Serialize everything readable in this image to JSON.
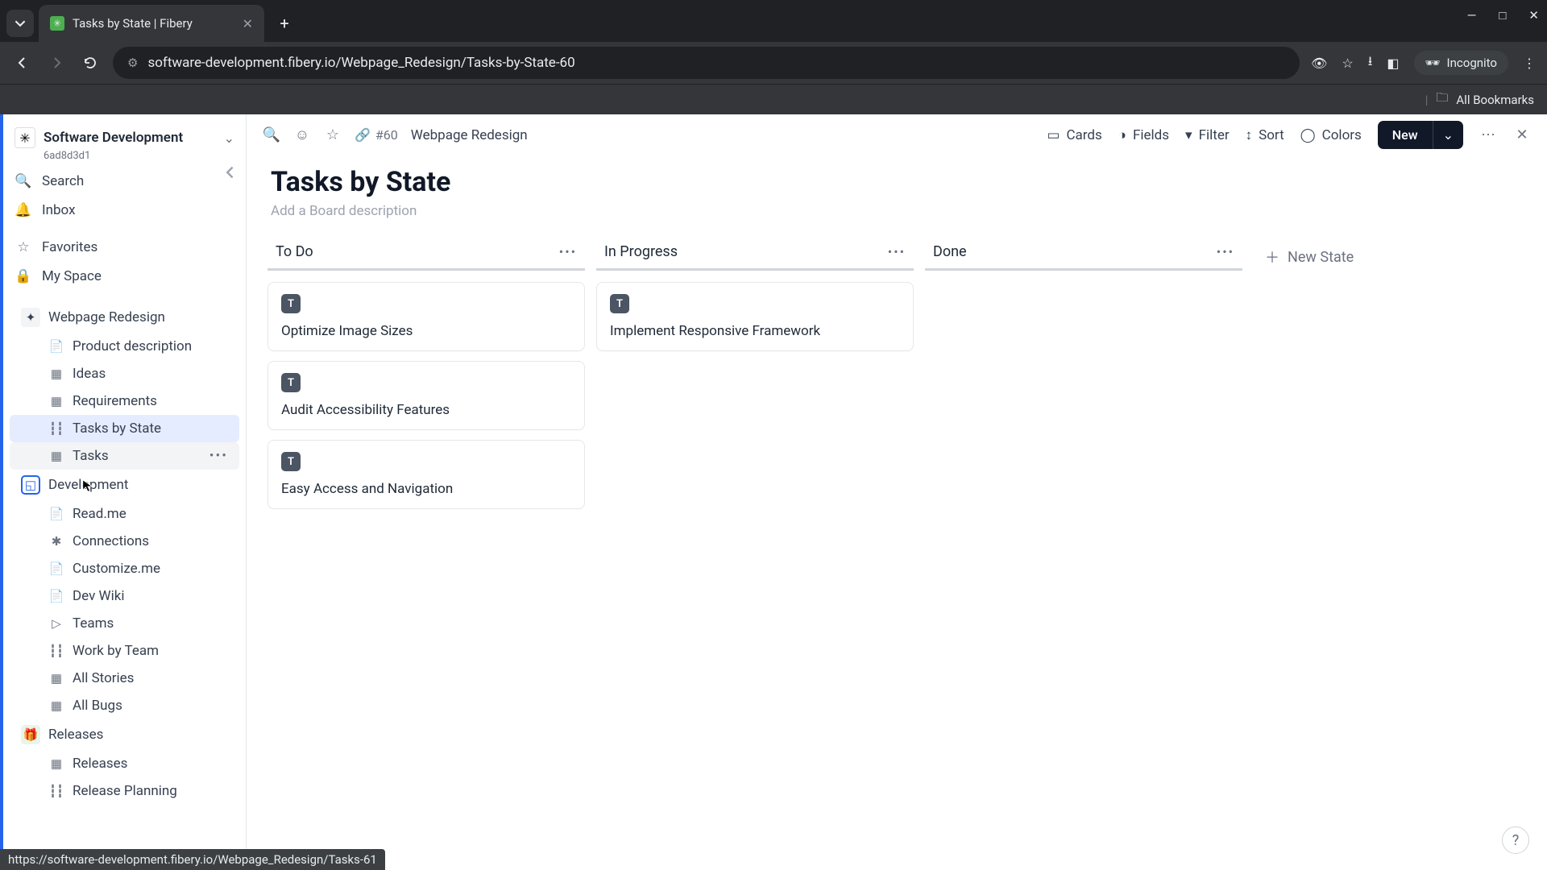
{
  "browser": {
    "tab_title": "Tasks by State | Fibery",
    "url": "software-development.fibery.io/Webpage_Redesign/Tasks-by-State-60",
    "incognito_label": "Incognito",
    "all_bookmarks": "All Bookmarks",
    "status_url": "https://software-development.fibery.io/Webpage_Redesign/Tasks-61"
  },
  "workspace": {
    "name": "Software Development",
    "id": "6ad8d3d1"
  },
  "sidebar": {
    "search": "Search",
    "inbox": "Inbox",
    "favorites": "Favorites",
    "my_space": "My Space",
    "spaces": [
      {
        "name": "Webpage Redesign",
        "icon": "sparkle",
        "children": [
          {
            "label": "Product description",
            "icon": "doc"
          },
          {
            "label": "Ideas",
            "icon": "grid"
          },
          {
            "label": "Requirements",
            "icon": "grid"
          },
          {
            "label": "Tasks by State",
            "icon": "board",
            "selected": true
          },
          {
            "label": "Tasks",
            "icon": "grid",
            "hovered": true
          }
        ]
      },
      {
        "name": "Development",
        "icon": "cube-blue",
        "children": [
          {
            "label": "Read.me",
            "icon": "doc"
          },
          {
            "label": "Connections",
            "icon": "connections"
          },
          {
            "label": "Customize.me",
            "icon": "doc"
          },
          {
            "label": "Dev Wiki",
            "icon": "doc"
          },
          {
            "label": "Teams",
            "icon": "play"
          },
          {
            "label": "Work by Team",
            "icon": "board"
          },
          {
            "label": "All Stories",
            "icon": "grid"
          },
          {
            "label": "All Bugs",
            "icon": "grid"
          }
        ]
      },
      {
        "name": "Releases",
        "icon": "gift-green",
        "children": [
          {
            "label": "Releases",
            "icon": "grid"
          },
          {
            "label": "Release Planning",
            "icon": "board"
          }
        ]
      }
    ]
  },
  "view": {
    "crumb_number": "#60",
    "crumb_parent": "Webpage Redesign",
    "toolbar": {
      "cards": "Cards",
      "fields": "Fields",
      "filter": "Filter",
      "sort": "Sort",
      "colors": "Colors",
      "new": "New"
    },
    "title": "Tasks by State",
    "description_placeholder": "Add a Board description",
    "new_state": "New State"
  },
  "board": {
    "columns": [
      {
        "title": "To Do",
        "cards": [
          {
            "badge": "T",
            "title": "Optimize Image Sizes"
          },
          {
            "badge": "T",
            "title": "Audit Accessibility Features"
          },
          {
            "badge": "T",
            "title": "Easy Access and Navigation"
          }
        ]
      },
      {
        "title": "In Progress",
        "cards": [
          {
            "badge": "T",
            "title": "Implement Responsive Framework"
          }
        ]
      },
      {
        "title": "Done",
        "cards": []
      }
    ]
  },
  "help": "?"
}
